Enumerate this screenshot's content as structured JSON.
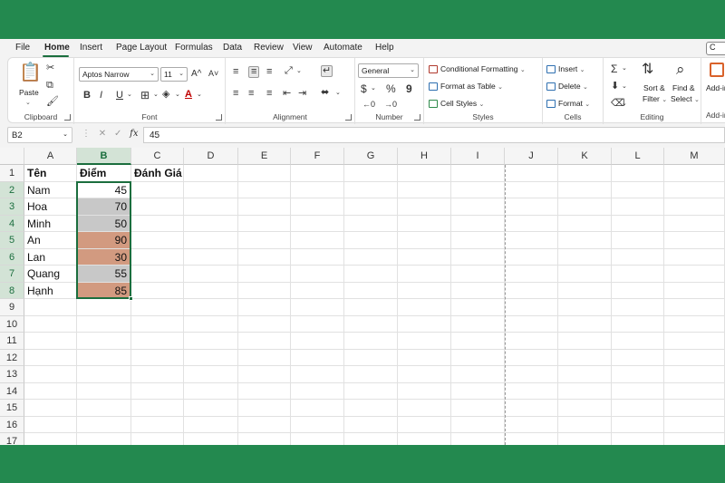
{
  "menu": {
    "tabs": [
      "File",
      "Home",
      "Insert",
      "Page Layout",
      "Formulas",
      "Data",
      "Review",
      "View",
      "Automate",
      "Help"
    ],
    "active": "Home",
    "share_label": "C"
  },
  "ribbon": {
    "clipboard": {
      "paste_label": "Paste",
      "group_label": "Clipboard"
    },
    "font": {
      "font_name": "Aptos Narrow",
      "font_size": "11",
      "grow_label": "A^",
      "shrink_label": "A˅",
      "bold": "B",
      "italic": "I",
      "underline": "U",
      "font_color_glyph": "A",
      "group_label": "Font"
    },
    "alignment": {
      "group_label": "Alignment"
    },
    "number": {
      "format": "General",
      "currency": "$",
      "percent": "%",
      "comma": "9",
      "group_label": "Number"
    },
    "styles": {
      "conditional": "Conditional Formatting",
      "format_table": "Format as Table",
      "cell_styles": "Cell Styles",
      "group_label": "Styles"
    },
    "cells": {
      "insert": "Insert",
      "delete": "Delete",
      "format": "Format",
      "group_label": "Cells"
    },
    "editing": {
      "sort_filter_1": "Sort &",
      "sort_filter_2": "Filter",
      "find_select_1": "Find &",
      "find_select_2": "Select",
      "group_label": "Editing"
    },
    "addins": {
      "label": "Add-in",
      "group_label": "Add-in"
    }
  },
  "formula_bar": {
    "name_box": "B2",
    "fx": "fx",
    "value": "45"
  },
  "sheet": {
    "columns": [
      "A",
      "B",
      "C",
      "D",
      "E",
      "F",
      "G",
      "H",
      "I",
      "J",
      "K",
      "L",
      "M"
    ],
    "selected_column": "B",
    "rows": [
      "1",
      "2",
      "3",
      "4",
      "5",
      "6",
      "7",
      "8",
      "9",
      "10",
      "11",
      "12",
      "13",
      "14",
      "15",
      "16",
      "17"
    ],
    "header_row": [
      "Tên",
      "Điểm",
      "Đánh Giá"
    ],
    "data": [
      {
        "name": "Nam",
        "score": "45",
        "fill": "#ffffff"
      },
      {
        "name": "Hoa",
        "score": "70",
        "fill": "#c8c8c8"
      },
      {
        "name": "Minh",
        "score": "50",
        "fill": "#c8c8c8"
      },
      {
        "name": "An",
        "score": "90",
        "fill": "#d29a80"
      },
      {
        "name": "Lan",
        "score": "30",
        "fill": "#d29a80"
      },
      {
        "name": "Quang",
        "score": "55",
        "fill": "#c8c8c8"
      },
      {
        "name": "Hạnh",
        "score": "85",
        "fill": "#d29a80"
      }
    ],
    "colors": {
      "accent": "#1b6e3e",
      "background": "#23894f"
    }
  }
}
